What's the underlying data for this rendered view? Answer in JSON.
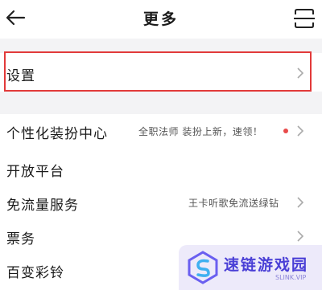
{
  "header": {
    "title": "更多",
    "back_icon": "arrow-left-icon",
    "scan_icon": "scan-icon"
  },
  "menu": {
    "items": [
      {
        "label": "设置",
        "sub": "",
        "chevron": true
      },
      {
        "label": "个性化装扮中心",
        "sub": "全职法师 装扮上新，速领！",
        "badge_dot": true,
        "chevron": true
      },
      {
        "label": "开放平台",
        "sub": "",
        "chevron": false
      },
      {
        "label": "免流量服务",
        "sub": "王卡听歌免流送绿钻",
        "chevron": true
      },
      {
        "label": "票务",
        "sub": "",
        "chevron": true
      },
      {
        "label": "百变彩铃",
        "sub": "",
        "chevron": false
      }
    ]
  },
  "watermark": {
    "text": "速链游戏园",
    "url": "SLINK.VIP",
    "logo_icon": "slink-logo-icon"
  },
  "colors": {
    "background": "#ffffff",
    "section_gap": "#f3f3f5",
    "highlight_border": "#e23a3a",
    "badge_dot": "#e84a4a",
    "chevron": "#aaaaaa",
    "watermark_accent": "#4a3fd6"
  }
}
